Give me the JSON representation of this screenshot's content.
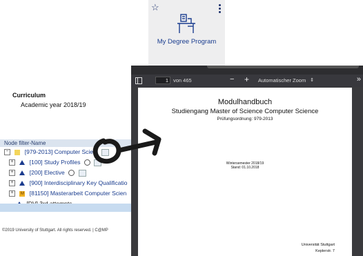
{
  "tile": {
    "label": "My Degree Program",
    "icons": {
      "favorite": "star-outline-icon",
      "menu": "kebab-menu-icon",
      "program": "desk-chair-icon"
    },
    "accent": "#1a3d8f"
  },
  "curriculum": {
    "title": "Curriculum",
    "year": "Academic year 2018/19"
  },
  "tree": {
    "filter_label": "Node filter-Name",
    "root": {
      "toggle": "−",
      "label": "[979-2013] Computer Scie..."
    },
    "items": [
      {
        "toggle": "+",
        "label": "[100] Study Profiles",
        "icon": "triangle"
      },
      {
        "toggle": "+",
        "label": "[200] Elective",
        "icon": "triangle"
      },
      {
        "toggle": "+",
        "label": "[900] Interdisciplinary Key Qualificatio",
        "icon": "triangle"
      },
      {
        "toggle": "+",
        "label": "[81150] Masterarbeit Computer Scien",
        "icon": "square-m"
      }
    ],
    "leaf": {
      "label": "[DV] 3rd attempts"
    }
  },
  "footer": "©2019 University of Stuttgart. All rights reserved. | C@MP",
  "viewer": {
    "page_number": "1",
    "page_total": "von 465",
    "zoom_out": "−",
    "zoom_in": "+",
    "zoom_mode": "Automatischer Zoom",
    "zoom_chevron": "⇕",
    "more": "»"
  },
  "pdf_page": {
    "title": "Modulhandbuch",
    "subtitle": "Studiengang Master of Science Computer Science",
    "regulation": "Prüfungsordnung: 979-2013",
    "semester": "Wintersemester 2018/19",
    "date": "Stand: 01.10.2018",
    "university": "Universität Stuttgart",
    "street": "Keplerstr. 7"
  }
}
